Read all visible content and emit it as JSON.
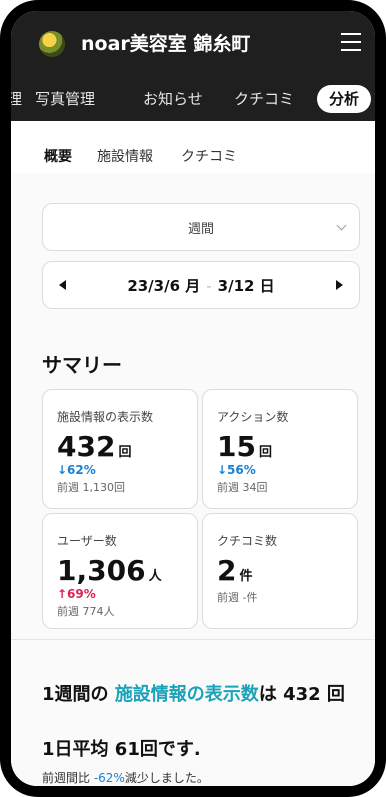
{
  "header": {
    "brand": "noar美容室 錦糸町",
    "logo": "salon-logo-icon",
    "menu": "hamburger-menu-icon"
  },
  "tabs": [
    {
      "label": "理"
    },
    {
      "label": "写真管理"
    },
    {
      "label": "お知らせ"
    },
    {
      "label": "クチコミ"
    },
    {
      "label": "分析",
      "active": true
    }
  ],
  "subtabs": [
    {
      "label": "概要",
      "active": true
    },
    {
      "label": "施設情報"
    },
    {
      "label": "クチコミ"
    }
  ],
  "period": {
    "selected": "週間"
  },
  "range": {
    "start": "23/3/6 月",
    "sep": "-",
    "end": "3/12 日"
  },
  "summary": {
    "title": "サマリー",
    "cards": [
      {
        "label": "施設情報の表示数",
        "value": "432",
        "unit": "回",
        "change": "↓62%",
        "prev": "前週 1,130回"
      },
      {
        "label": "アクション数",
        "value": "15",
        "unit": "回",
        "change": "↓56%",
        "prev": "前週 34回"
      },
      {
        "label": "ユーザー数",
        "value": "1,306",
        "unit": "人",
        "change": "↑69%",
        "prev": "前週 774人"
      },
      {
        "label": "クチコミ数",
        "value": "2",
        "unit": "件",
        "change": "",
        "prev": "前週 -件"
      }
    ]
  },
  "insight": {
    "prefix": "1週間の",
    "highlight": "施設情報の表示数",
    "suffix": "は 432 回",
    "line2": "1日平均 61回です.",
    "note_prefix": "前週間比 ",
    "note_value": "-62%",
    "note_suffix": "減少しました。"
  },
  "colors": {
    "accent": "#1aa3b8",
    "down": "#1a80d6",
    "up": "#e02050",
    "bar": "#1f1f1f"
  }
}
